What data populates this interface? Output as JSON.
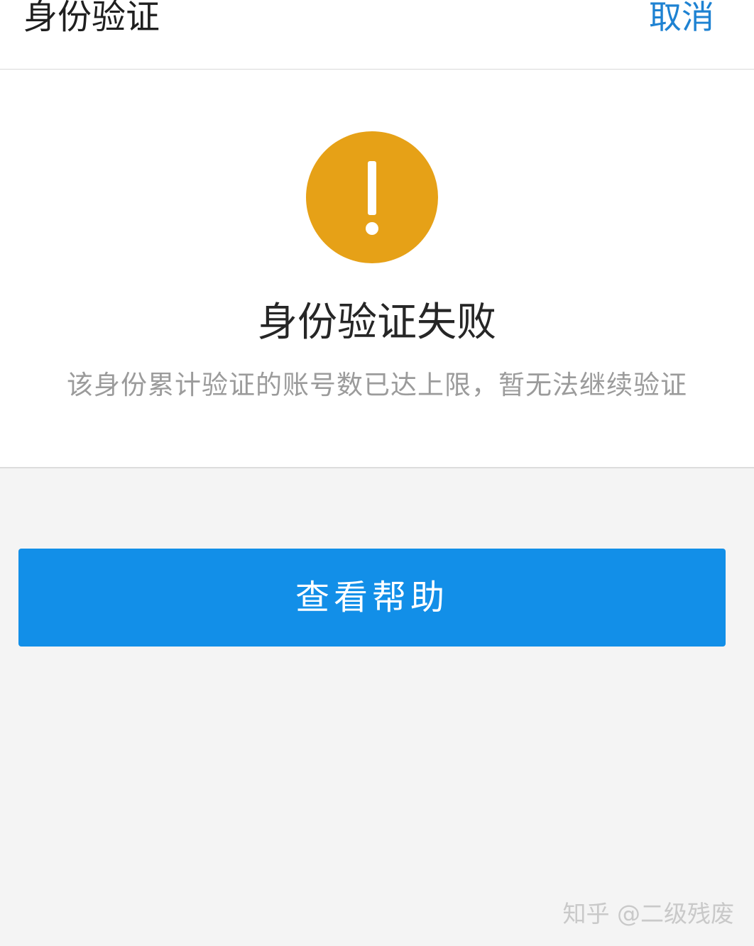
{
  "header": {
    "title": "身份验证",
    "cancel_label": "取消"
  },
  "result": {
    "icon": "warning-icon",
    "icon_color": "#E6A117",
    "title": "身份验证失败",
    "description": "该身份累计验证的账号数已达上限，暂无法继续验证"
  },
  "actions": {
    "help_label": "查看帮助",
    "help_color": "#128FE8"
  },
  "watermark": {
    "text": "知乎 @二级残废"
  }
}
